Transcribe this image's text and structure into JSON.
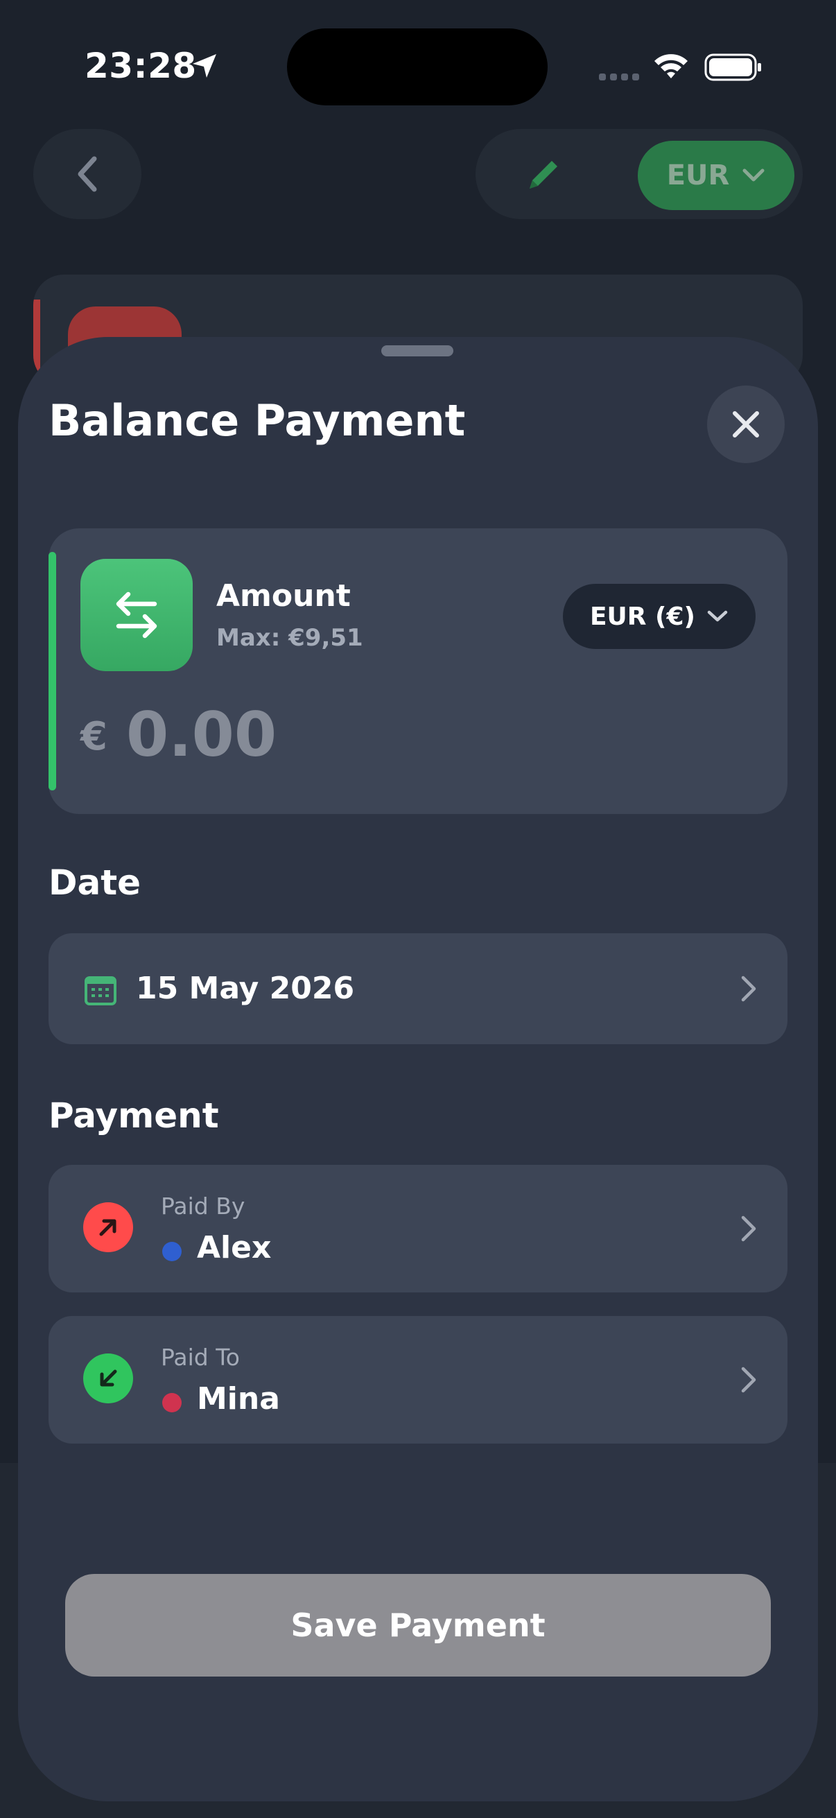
{
  "status_bar": {
    "time": "23:28"
  },
  "background": {
    "currency_label": "EUR",
    "accent_color": "#2a7a48"
  },
  "sheet": {
    "title": "Balance Payment",
    "amount": {
      "label": "Amount",
      "max_text": "Max: €9,51",
      "currency_button_label": "EUR (€)",
      "symbol": "€",
      "placeholder": "0.00",
      "icon": "arrows-swap-icon",
      "accent_color": "#34c26a"
    },
    "date": {
      "section_label": "Date",
      "value": "15 May 2026",
      "icon": "calendar-icon"
    },
    "payment": {
      "section_label": "Payment",
      "paid_by": {
        "caption": "Paid By",
        "name": "Alex",
        "badge_color": "#ff4b4b",
        "dot_color": "#2f5fd0"
      },
      "paid_to": {
        "caption": "Paid To",
        "name": "Mina",
        "badge_color": "#30c55e",
        "dot_color": "#d0334f"
      }
    },
    "save_button_label": "Save Payment"
  }
}
